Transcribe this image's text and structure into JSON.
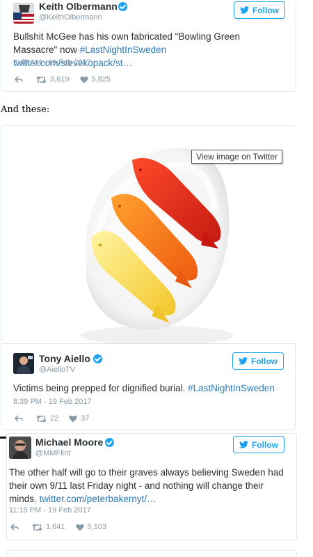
{
  "tweets": [
    {
      "name": "Keith Olbermann",
      "handle": "@KeithOlbermann",
      "follow_label": "Follow",
      "text_plain": "Bullshit McGee has his own fabricated \"Bowling Green Massacre\" now ",
      "text_link": "#LastNightInSweden twitter.com/stevekopack/st…",
      "timestamp": "3:48 AM - 19 Feb 2017",
      "retweets": "3,619",
      "likes": "5,825"
    },
    {
      "name": "Tony Aiello",
      "handle": "@AielloTV",
      "follow_label": "Follow",
      "text_plain": "Victims being prepped for dignified burial. ",
      "text_link": "#LastNightInSweden",
      "timestamp": "8:39 PM - 19 Feb 2017",
      "retweets": "22",
      "likes": "37"
    },
    {
      "name": "Michael Moore",
      "handle": "@MMFlint",
      "follow_label": "Follow",
      "text_plain": "The other half will go to their graves always believing Sweden had their own 9/11 last Friday night - and nothing will change their minds. ",
      "text_link": "twitter.com/peterbakernyt/…",
      "timestamp": "11:15 PM - 19 Feb 2017",
      "retweets": "1,641",
      "likes": "5,103"
    }
  ],
  "between_text": "And these:",
  "photo_tooltip": "View image on Twitter",
  "colors": {
    "twitter_blue": "#1da1f2",
    "link_blue": "#2b7bb9",
    "meta_gray": "#8899a6",
    "border": "#e1e8ed"
  },
  "icons": [
    "twitter-bird-icon",
    "verified-icon",
    "reply-icon",
    "retweet-icon",
    "like-icon"
  ]
}
